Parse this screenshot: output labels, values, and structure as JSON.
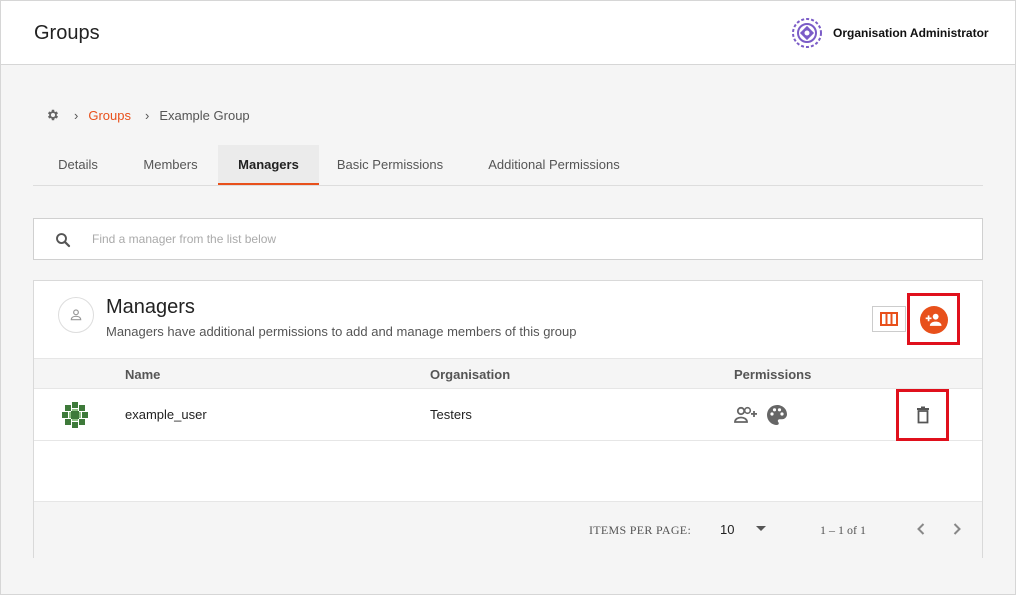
{
  "header": {
    "title": "Groups",
    "org_name": "Organisation Administrator",
    "org_logo_icon": "organisation-logo-icon"
  },
  "breadcrumb": {
    "home_icon": "gear-icon",
    "items": [
      "Groups",
      "Example Group"
    ]
  },
  "tabs": [
    {
      "label": "Details",
      "active": false
    },
    {
      "label": "Members",
      "active": false
    },
    {
      "label": "Managers",
      "active": true
    },
    {
      "label": "Basic Permissions",
      "active": false
    },
    {
      "label": "Additional Permissions",
      "active": false
    }
  ],
  "search": {
    "placeholder": "Find a manager from the list below",
    "value": ""
  },
  "panel": {
    "title": "Managers",
    "subtitle": "Managers have additional permissions to add and manage members of this group",
    "icon": "person-icon",
    "column_toggle_icon": "columns-icon",
    "add_button_icon": "add-person-icon"
  },
  "table": {
    "columns": [
      "Name",
      "Organisation",
      "Permissions"
    ],
    "rows": [
      {
        "name": "example_user",
        "organisation": "Testers",
        "permission_icons": [
          "add-members-icon",
          "palette-icon"
        ],
        "action_icon": "trash-icon"
      }
    ]
  },
  "paginator": {
    "items_per_page_label": "ITEMS PER PAGE:",
    "items_per_page": "10",
    "range": "1 – 1 of 1"
  },
  "colors": {
    "accent": "#e8501b",
    "highlight": "#e0101c",
    "logo": "#7b5cc7",
    "avatar": "#3e7a3a"
  }
}
